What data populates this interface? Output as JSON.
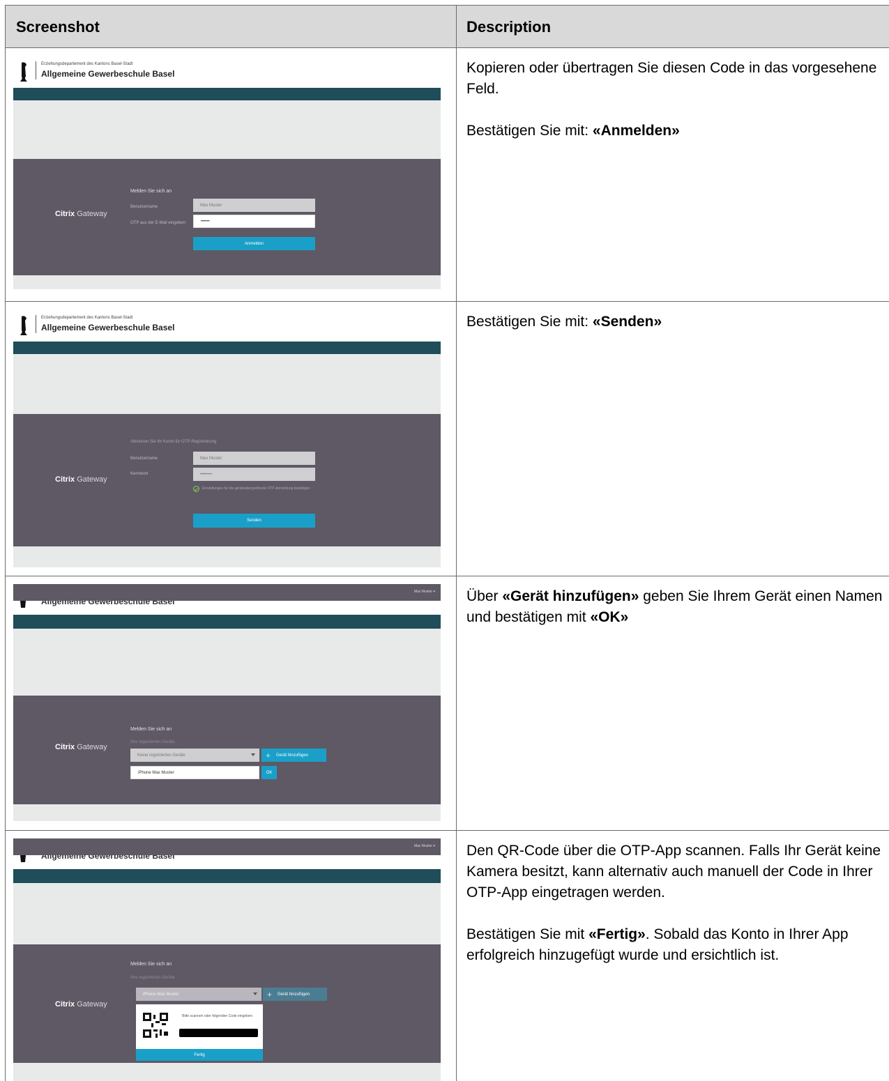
{
  "table": {
    "header": {
      "col1": "Screenshot",
      "col2": "Description"
    }
  },
  "mock": {
    "department": "Erziehungsdepartement des Kantons Basel-Stadt",
    "school": "Allgemeine Gewerbeschule Basel",
    "citrix_brand": "Citrix",
    "citrix_product": "Gateway",
    "username_user": "Max Muster"
  },
  "rows": [
    {
      "desc": [
        "Kopieren oder übertragen Sie diesen Code in das vorgesehene Feld.",
        ""
      ],
      "confirm_prefix": "Bestätigen Sie mit: ",
      "confirm_bold": "«Anmelden»",
      "form": {
        "title": "Melden Sie sich an",
        "label1": "Benutzername",
        "label2": "OTP aus der E-Mail eingeben",
        "value1": "Max Muster",
        "value2": "••••••",
        "button": "Anmelden"
      }
    },
    {
      "confirm_prefix": "Bestätigen Sie mit: ",
      "confirm_bold": "«Senden»",
      "form": {
        "title": "Aktivieren Sie Ihr Konto für OTP-Registrierung",
        "label1": "Benutzername",
        "label2": "Kennwort",
        "value1": "Max Muster",
        "value2": "••••••••",
        "check_text": "Einstellungen für die geräteübergreifende OTP-Anmeldung bestätigen",
        "button": "Senden"
      }
    },
    {
      "text_prefix": "Über ",
      "text_bold1": "«Gerät hinzufügen»",
      "text_mid": " geben Sie Ihrem Gerät einen Namen und bestätigen mit ",
      "text_bold2": "«OK»",
      "form": {
        "title": "Melden Sie sich an",
        "subtitle": "Ihre registrierten Geräte",
        "select": "Keine registrierten Geräte",
        "add_button": "Gerät hinzufügen",
        "name_value": "iPhone Max Muster",
        "ok_button": "OK"
      }
    },
    {
      "para1": "Den QR-Code über die OTP-App scannen. Falls Ihr Gerät keine Kamera besitzt, kann alternativ auch manuell der Code in Ihrer OTP-App eingetragen werden.",
      "para2_prefix": "Bestätigen Sie mit ",
      "para2_bold": "«Fertig»",
      "para2_suffix": ". Sobald das Konto in Ihrer App erfolgreich hinzugefügt wurde und ersichtlich ist.",
      "form": {
        "title": "Melden Sie sich an",
        "subtitle": "Ihre registrierten Geräte",
        "select": "iPhone Max Muster",
        "add_button": "Gerät hinzufügen",
        "qr_text": "Bitte scannen oder folgenden Code eingeben:",
        "done_button": "Fertig"
      }
    }
  ]
}
